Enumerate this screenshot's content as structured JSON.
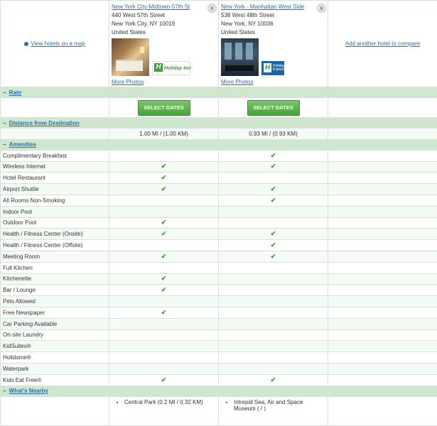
{
  "view_map_label": "View hotels on a map",
  "add_hotel_label": "Add another hotel to compare",
  "more_photos_label": "More Photos",
  "close_glyph": "x",
  "hotels": [
    {
      "name": "New York City-Midtown-57th St",
      "address1": "440 West 57th Street",
      "address2": "New York City, NY 10019",
      "country": "United States",
      "logo_text": "Holiday Inn"
    },
    {
      "name": "New York - Manhattan West Side",
      "address1": "538 West 48th Street",
      "address2": "New York, NY 10036",
      "country": "United States",
      "logo_text": "Holiday Inn Express"
    }
  ],
  "sections": {
    "rate": "Rate",
    "distance": "Distance from Destination",
    "amenities": "Amenities",
    "nearby": "What's Nearby"
  },
  "select_dates_label": "SELECT DATES",
  "distances": [
    "1.00 MI / (1.00 KM)",
    "0.93 MI / (0.93 KM)"
  ],
  "check_glyph": "✔",
  "amenities": [
    {
      "name": "Complimentary Breakfast",
      "h1": false,
      "h2": true
    },
    {
      "name": "Wireless Internet",
      "h1": true,
      "h2": true
    },
    {
      "name": "Hotel Restaurant",
      "h1": true,
      "h2": false
    },
    {
      "name": "Airport Shuttle",
      "h1": true,
      "h2": true
    },
    {
      "name": "All Rooms Non-Smoking",
      "h1": false,
      "h2": true
    },
    {
      "name": "Indoor Pool",
      "h1": false,
      "h2": false
    },
    {
      "name": "Outdoor Pool",
      "h1": true,
      "h2": false
    },
    {
      "name": "Health / Fitness Center (Onsite)",
      "h1": true,
      "h2": true
    },
    {
      "name": "Health / Fitness Center (Offsite)",
      "h1": false,
      "h2": true
    },
    {
      "name": "Meeting Room",
      "h1": true,
      "h2": true
    },
    {
      "name": "Full Kitchen",
      "h1": false,
      "h2": false
    },
    {
      "name": "Kitchenette",
      "h1": true,
      "h2": false
    },
    {
      "name": "Bar / Lounge",
      "h1": true,
      "h2": false
    },
    {
      "name": "Pets Allowed",
      "h1": false,
      "h2": false
    },
    {
      "name": "Free Newspaper",
      "h1": true,
      "h2": false
    },
    {
      "name": "Car Parking Available",
      "h1": false,
      "h2": false
    },
    {
      "name": "On-site Laundry",
      "h1": false,
      "h2": false
    },
    {
      "name": "KidSuites®",
      "h1": false,
      "h2": false
    },
    {
      "name": "Holidome®",
      "h1": false,
      "h2": false
    },
    {
      "name": "Waterpark",
      "h1": false,
      "h2": false
    },
    {
      "name": "Kids Eat Free®",
      "h1": true,
      "h2": true
    }
  ],
  "nearby": [
    [
      "Central Park (0.2 MI / 0.32 KM)"
    ],
    [
      "Intrepid Sea, Air and Space Museum ( / )"
    ]
  ]
}
